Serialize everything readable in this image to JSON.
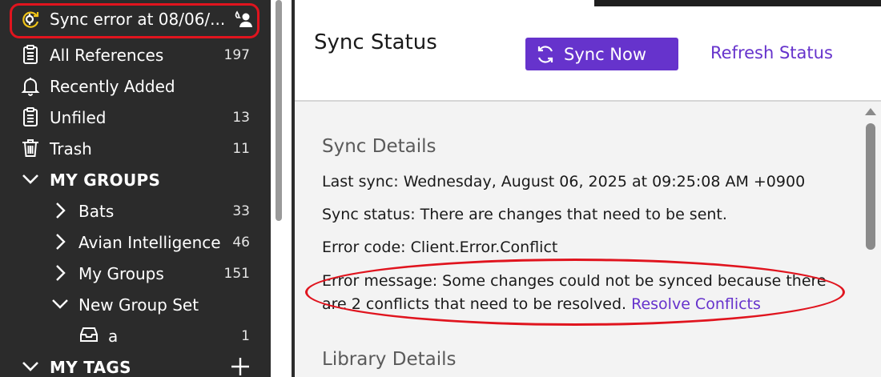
{
  "sidebar": {
    "sync_error": "Sync error at 08/06/...",
    "items": [
      {
        "label": "All References",
        "count": "197",
        "icon": "clipboard-icon"
      },
      {
        "label": "Recently Added",
        "count": "",
        "icon": "bell-icon"
      },
      {
        "label": "Unfiled",
        "count": "13",
        "icon": "clipboard-icon"
      },
      {
        "label": "Trash",
        "count": "11",
        "icon": "trash-icon"
      }
    ],
    "my_groups": "MY GROUPS",
    "groups": [
      {
        "label": "Bats",
        "count": "33"
      },
      {
        "label": "Avian Intelligence",
        "count": "46"
      },
      {
        "label": "My Groups",
        "count": "151"
      },
      {
        "label": "New Group Set",
        "count": ""
      }
    ],
    "subgroup": {
      "label": "a",
      "count": "1"
    },
    "my_tags": "MY TAGS"
  },
  "main": {
    "title": "Sync Status",
    "sync_now": "Sync Now",
    "refresh_status": "Refresh Status",
    "sync_details": "Sync Details",
    "last_sync": "Last sync: Wednesday, August 06, 2025 at 09:25:08 AM +0900",
    "sync_status": "Sync status: There are changes that need to be sent.",
    "error_code": "Error code: Client.Error.Conflict",
    "error_message_1": "Error message: Some changes could not be synced because there",
    "error_message_2": "are 2 conflicts that need to be resolved.",
    "resolve_conflicts": "Resolve Conflicts",
    "library_details": "Library Details"
  },
  "colors": {
    "accent": "#6633cc",
    "sidebar_bg": "#2b2b2b",
    "highlight": "#e0141e"
  }
}
